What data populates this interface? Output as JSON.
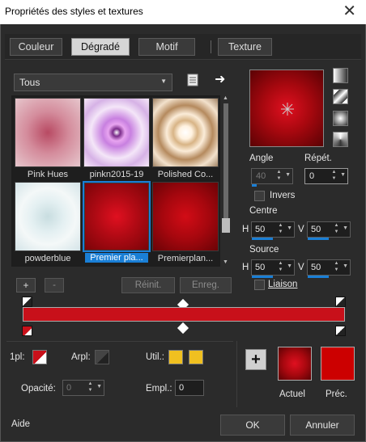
{
  "window": {
    "title": "Propriétés des styles et textures",
    "close_glyph": "✕"
  },
  "tabs": [
    "Couleur",
    "Dégradé",
    "Motif",
    "Texture"
  ],
  "active_tab": "Dégradé",
  "preset_combo": {
    "value": "Tous"
  },
  "presets": [
    {
      "label": "Pink Hues",
      "selected": false
    },
    {
      "label": "pinkn2015-19",
      "selected": false
    },
    {
      "label": "Polished Co...",
      "selected": false
    },
    {
      "label": "powderblue",
      "selected": false
    },
    {
      "label": "Premier pla...",
      "selected": true
    },
    {
      "label": "Premierplan...",
      "selected": false
    }
  ],
  "preset_buttons": {
    "add": "+",
    "remove": "-",
    "reset": "Réinit.",
    "save": "Enreg."
  },
  "angle": {
    "label": "Angle",
    "value": "40"
  },
  "repeat": {
    "label": "Répét.",
    "value": "0"
  },
  "invert": {
    "label": "Invers"
  },
  "centre": {
    "label": "Centre",
    "h_label": "H",
    "h_value": "50",
    "v_label": "V",
    "v_value": "50"
  },
  "source": {
    "label": "Source",
    "h_label": "H",
    "h_value": "50",
    "v_label": "V",
    "v_value": "50"
  },
  "link": {
    "label": "Liaison"
  },
  "stop_row": {
    "fg_label": "1pl:",
    "bg_label": "Arpl:",
    "user_label": "Util.:",
    "opacity_label": "Opacité:",
    "opacity_value": "0",
    "location_label": "Empl.:",
    "location_value": "0"
  },
  "compare": {
    "current_label": "Actuel",
    "previous_label": "Préc."
  },
  "footer": {
    "help": "Aide",
    "ok": "OK",
    "cancel": "Annuler"
  },
  "colors": {
    "accent": "#1a7fd6",
    "gradient_red": "#c8101a",
    "gold": "#f0c020",
    "previous_red": "#cc0000"
  }
}
